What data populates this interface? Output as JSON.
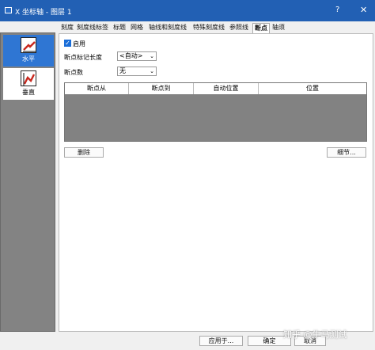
{
  "window": {
    "title": "X 坐标轴 - 图层 1",
    "help": "?",
    "close": "✕"
  },
  "sidebar": {
    "items": [
      {
        "label": "水平",
        "icon": "horizontal-axis-icon"
      },
      {
        "label": "垂直",
        "icon": "vertical-axis-icon"
      }
    ]
  },
  "tabs": [
    "刻度",
    "刻度线标签",
    "标题",
    "网格",
    "轴线和刻度线",
    "特殊刻度线",
    "参照线",
    "断点",
    "轴须"
  ],
  "active_tab": "断点",
  "breaks": {
    "enable_label": "启用",
    "mark_length_label": "断点标记长度",
    "mark_length_value": "<自动>",
    "count_label": "断点数",
    "count_value": "无"
  },
  "table": {
    "columns": [
      "断点从",
      "断点到",
      "自动位置",
      "位置"
    ]
  },
  "buttons": {
    "delete": "删除",
    "details": "细节...",
    "apply_to": "应用于...",
    "ok": "确定",
    "cancel": "取消"
  },
  "watermark": "知乎 @牛马测试"
}
